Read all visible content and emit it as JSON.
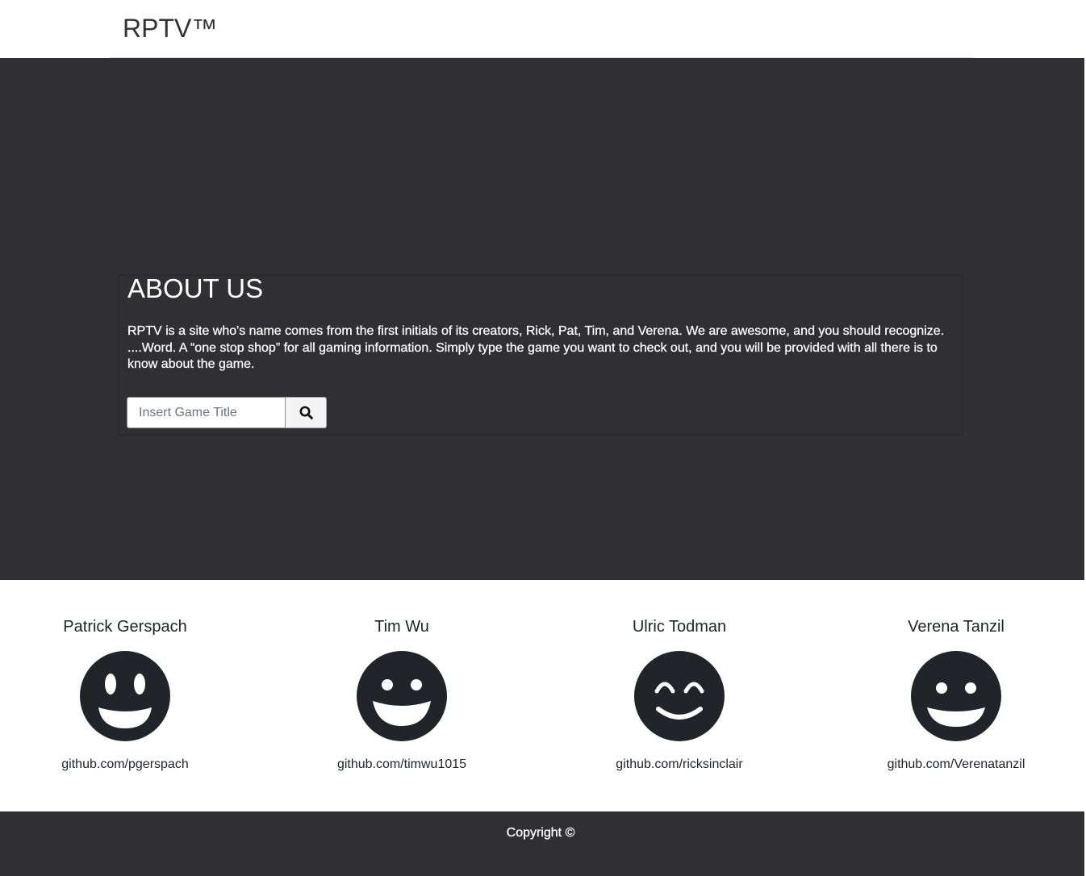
{
  "navbar": {
    "brand": "RPTV™"
  },
  "about": {
    "title": "ABOUT US",
    "text": "RPTV is a site who's name comes from the first initials of its creators, Rick, Pat, Tim, and Verena. We are awesome, and you should recognize. ....Word. A “one stop shop” for all gaming information. Simply type the game you want to check out, and you will be provided with all there is to know about the game.",
    "search": {
      "placeholder": "Insert Game Title",
      "value": "",
      "button_icon": "search-icon"
    }
  },
  "team": [
    {
      "name": "Patrick Gerspach",
      "avatar_icon": "grin-tall-icon",
      "github": "github.com/pgerspach"
    },
    {
      "name": "Tim Wu",
      "avatar_icon": "grin-icon",
      "github": "github.com/timwu1015"
    },
    {
      "name": "Ulric Todman",
      "avatar_icon": "smile-beam-icon",
      "github": "github.com/ricksinclair"
    },
    {
      "name": "Verena Tanzil",
      "avatar_icon": "grin-icon",
      "github": "github.com/Verenatanzil"
    }
  ],
  "footer": {
    "copyright": "Copyright ©"
  },
  "colors": {
    "dark_bg": "#303032",
    "text_dark": "#212529",
    "white": "#ffffff"
  }
}
